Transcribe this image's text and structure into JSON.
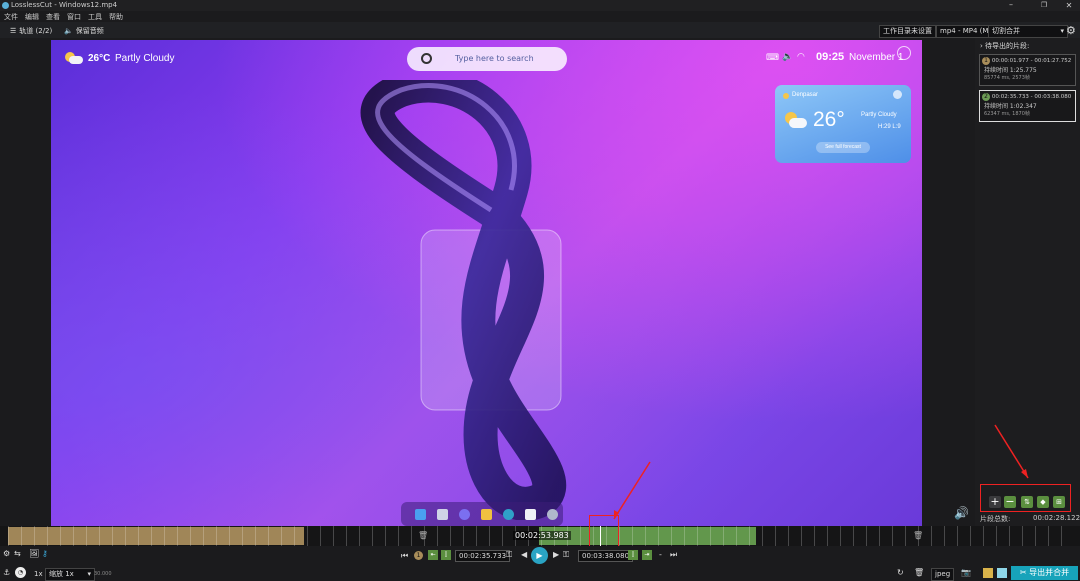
{
  "window": {
    "title": "LosslessCut - Windows12.mp4"
  },
  "menu": [
    "文件",
    "编辑",
    "查看",
    "窗口",
    "工具",
    "帮助"
  ],
  "toolbar": {
    "tracks": "轨道 (2/2)",
    "keep_audio": "保留音频",
    "workdir": "工作目录未设置",
    "format": "mp4 - MP4 (M",
    "mode": "切割合并"
  },
  "video": {
    "weather_temp": "26°C",
    "weather_desc": "Partly Cloudy",
    "search_placeholder": "Type here to search",
    "clock": "09:25",
    "date": "November 1",
    "card": {
      "city": "Denpasar",
      "temp": "26°",
      "cond": "Partly Cloudy",
      "hl": "H:29 L:9",
      "button": "See full forecast"
    }
  },
  "panel": {
    "header": "待导出的片段:",
    "segments": [
      {
        "num": "1",
        "range": "00:00:01.977 - 00:01:27.752",
        "duration": "持续时间 1:25.775",
        "frames": "85774 ms, 2573帧",
        "color": "#a88d5a"
      },
      {
        "num": "2",
        "range": "00:02:35.733 - 00:03:38.080",
        "duration": "持续时间 1:02.347",
        "frames": "62347 ms, 1870帧",
        "color": "#6c9a55"
      }
    ],
    "seg_count_label": "片段总数:",
    "seg_total": "00:02:28.122"
  },
  "timeline": {
    "current": "00:02:53.983"
  },
  "controls": {
    "seg_index": "1",
    "start": "00:02:35.733",
    "end": "00:03:38.080",
    "dash": "-"
  },
  "bottom": {
    "speed": "1x",
    "zoom": "缩放 1x",
    "fps": "30.000",
    "format": "jpeg",
    "export": "导出并合并"
  }
}
